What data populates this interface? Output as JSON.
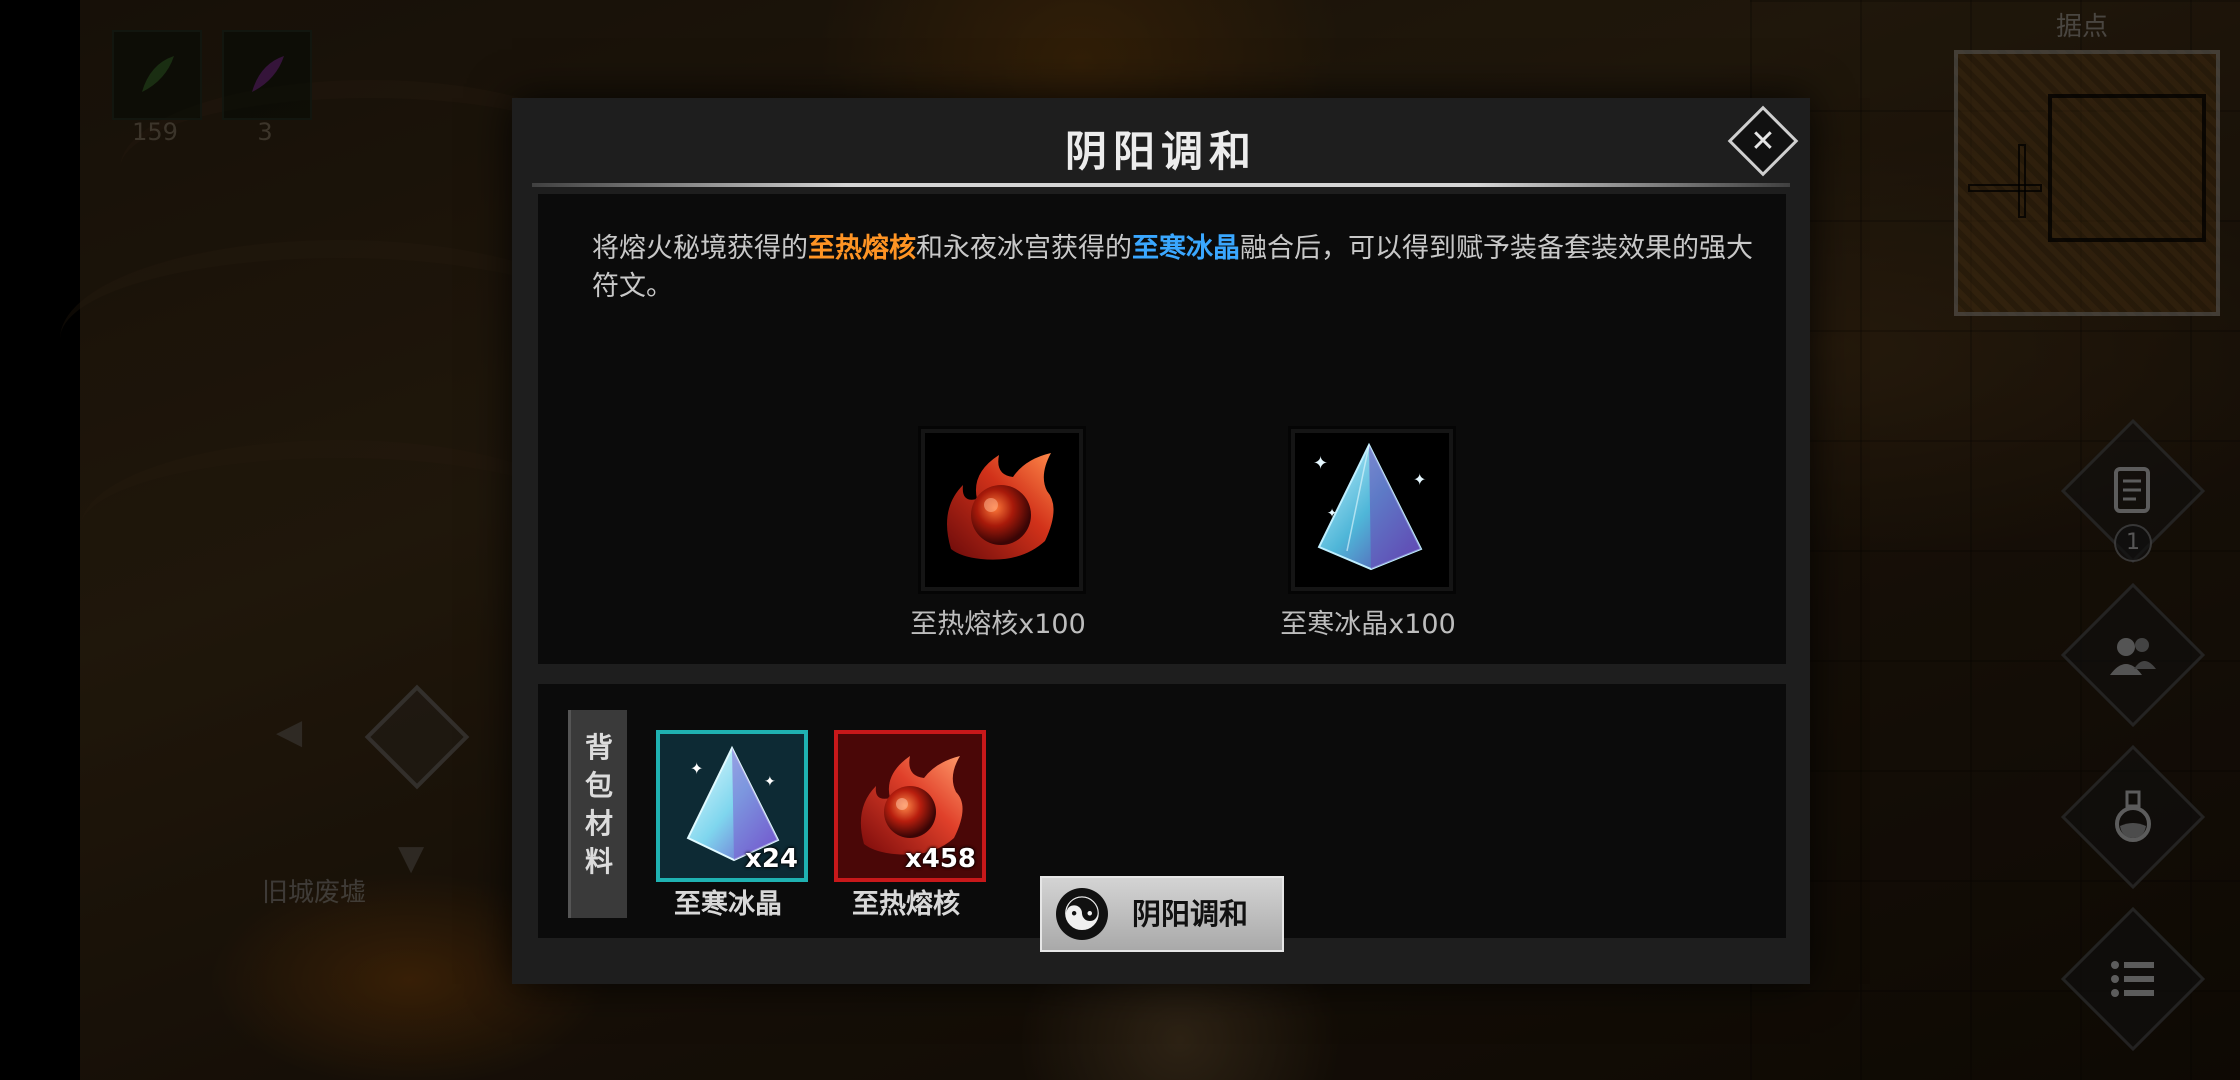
{
  "hud": {
    "slots": [
      {
        "icon": "green-feather-icon",
        "count": "159"
      },
      {
        "icon": "purple-feather-icon",
        "count": "3"
      }
    ]
  },
  "map": {
    "label": "据点"
  },
  "area": {
    "name": "旧城废墟"
  },
  "side_buttons": [
    {
      "icon": "quest-scroll-icon",
      "badge": "1"
    },
    {
      "icon": "party-icon"
    },
    {
      "icon": "potion-icon"
    },
    {
      "icon": "menu-list-icon"
    }
  ],
  "dialog": {
    "title": "阴阳调和",
    "close_label": "✕",
    "description": {
      "part1": "将熔火秘境获得的",
      "fire_item": "至热熔核",
      "part2": "和永夜冰宫获得的",
      "ice_item": "至寒冰晶",
      "part3": "融合后，可以得到赋予装备套装效果的强大符文。"
    },
    "requirements": [
      {
        "icon": "fire-core-icon",
        "label": "至热熔核x100"
      },
      {
        "icon": "ice-crystal-icon",
        "label": "至寒冰晶x100"
      }
    ],
    "bag": {
      "tab_chars": [
        "背",
        "包",
        "材",
        "料"
      ],
      "items": [
        {
          "icon": "ice-crystal-icon",
          "count": "x24",
          "name": "至寒冰晶"
        },
        {
          "icon": "fire-core-icon",
          "count": "x458",
          "name": "至热熔核"
        }
      ]
    },
    "action": {
      "icon": "yin-yang-icon",
      "glyph": "☯",
      "label": "阴阳调和"
    }
  },
  "colors": {
    "fire_highlight": "#ff9424",
    "ice_highlight": "#3aa7ff",
    "ice_border": "#1fb2b2",
    "fire_border": "#c8181a"
  }
}
